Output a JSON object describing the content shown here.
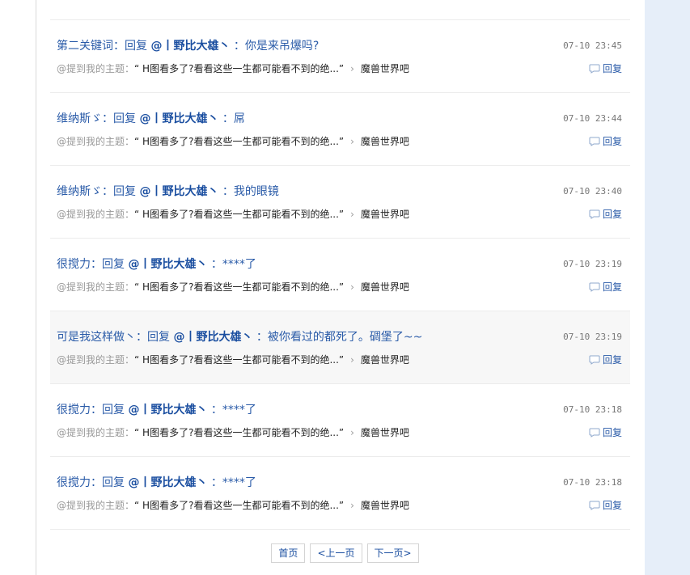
{
  "feed": {
    "items": [
      {
        "user": "第二关键词",
        "prefix": "：回复",
        "target": "@丨野比大雄丶",
        "content": "：你是来吊爆吗?",
        "time": "07-10 23:45",
        "mention_prefix": "@提到我的主题：",
        "thread_title": "“ H图看多了?看看这些一生都可能看不到的绝...”",
        "chevron": "›",
        "forum": "魔兽世界吧",
        "reply_label": "回复"
      },
      {
        "user": "维纳斯ゞ",
        "prefix": "：回复",
        "target": "@丨野比大雄丶",
        "content": "：屌",
        "time": "07-10 23:44",
        "mention_prefix": "@提到我的主题：",
        "thread_title": "“ H图看多了?看看这些一生都可能看不到的绝...”",
        "chevron": "›",
        "forum": "魔兽世界吧",
        "reply_label": "回复"
      },
      {
        "user": "维纳斯ゞ",
        "prefix": "：回复",
        "target": "@丨野比大雄丶",
        "content": "：我的眼镜",
        "time": "07-10 23:40",
        "mention_prefix": "@提到我的主题：",
        "thread_title": "“ H图看多了?看看这些一生都可能看不到的绝...”",
        "chevron": "›",
        "forum": "魔兽世界吧",
        "reply_label": "回复"
      },
      {
        "user": "很搅力",
        "prefix": "：回复",
        "target": "@丨野比大雄丶",
        "content": "：****了",
        "time": "07-10 23:19",
        "mention_prefix": "@提到我的主题：",
        "thread_title": "“ H图看多了?看看这些一生都可能看不到的绝...”",
        "chevron": "›",
        "forum": "魔兽世界吧",
        "reply_label": "回复"
      },
      {
        "user": "可是我这样做丶",
        "prefix": "：回复",
        "target": "@丨野比大雄丶",
        "content": "：被你看过的都死了。碉堡了~~",
        "time": "07-10 23:19",
        "mention_prefix": "@提到我的主题：",
        "thread_title": "“ H图看多了?看看这些一生都可能看不到的绝...”",
        "chevron": "›",
        "forum": "魔兽世界吧",
        "reply_label": "回复"
      },
      {
        "user": "很搅力",
        "prefix": "：回复",
        "target": "@丨野比大雄丶",
        "content": "：****了",
        "time": "07-10 23:18",
        "mention_prefix": "@提到我的主题：",
        "thread_title": "“ H图看多了?看看这些一生都可能看不到的绝...”",
        "chevron": "›",
        "forum": "魔兽世界吧",
        "reply_label": "回复"
      },
      {
        "user": "很搅力",
        "prefix": "：回复",
        "target": "@丨野比大雄丶",
        "content": "：****了",
        "time": "07-10 23:18",
        "mention_prefix": "@提到我的主题：",
        "thread_title": "“ H图看多了?看看这些一生都可能看不到的绝...”",
        "chevron": "›",
        "forum": "魔兽世界吧",
        "reply_label": "回复"
      }
    ]
  },
  "pager": {
    "first": "首页",
    "prev": "<上一页",
    "next": "下一页>"
  },
  "colors": {
    "link_blue": "#2a5ba8",
    "right_strip": "#e6eef9",
    "highlight_row": "#f7f7f7"
  },
  "icons": {
    "reply": "speech-bubble-icon"
  }
}
